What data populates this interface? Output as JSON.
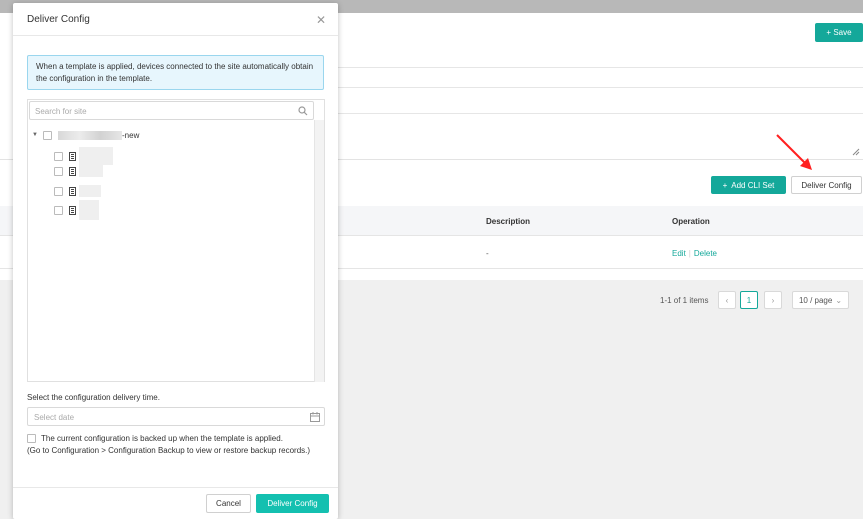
{
  "background": {
    "save_label": "Save",
    "add_cli_label": "Add CLI Set",
    "deliver_config_label": "Deliver Config",
    "table": {
      "headers": {
        "description": "Description",
        "operation": "Operation"
      },
      "rows": [
        {
          "description": "-",
          "edit": "Edit",
          "delete": "Delete"
        }
      ]
    },
    "pagination": {
      "summary": "1-1 of 1 items",
      "current_page": "1",
      "page_size": "10 / page"
    }
  },
  "modal": {
    "title": "Deliver Config",
    "info": "When a template is applied, devices connected to the site automatically obtain the configuration in the template.",
    "search_placeholder": "Search for site",
    "tree": {
      "root_suffix": "-new"
    },
    "time_label": "Select the configuration delivery time.",
    "date_placeholder": "Select date",
    "backup_text": "The current configuration is backed up when the template is applied.",
    "backup_note": "(Go to Configuration > Configuration Backup to view or restore backup records.)",
    "cancel_label": "Cancel",
    "deliver_label": "Deliver Config"
  },
  "colors": {
    "accent": "#14a89a",
    "primary_button": "#14c0b0",
    "info_bg": "#e7f6fd",
    "info_border": "#9ad6ee",
    "annotation_arrow": "#ff2020"
  }
}
